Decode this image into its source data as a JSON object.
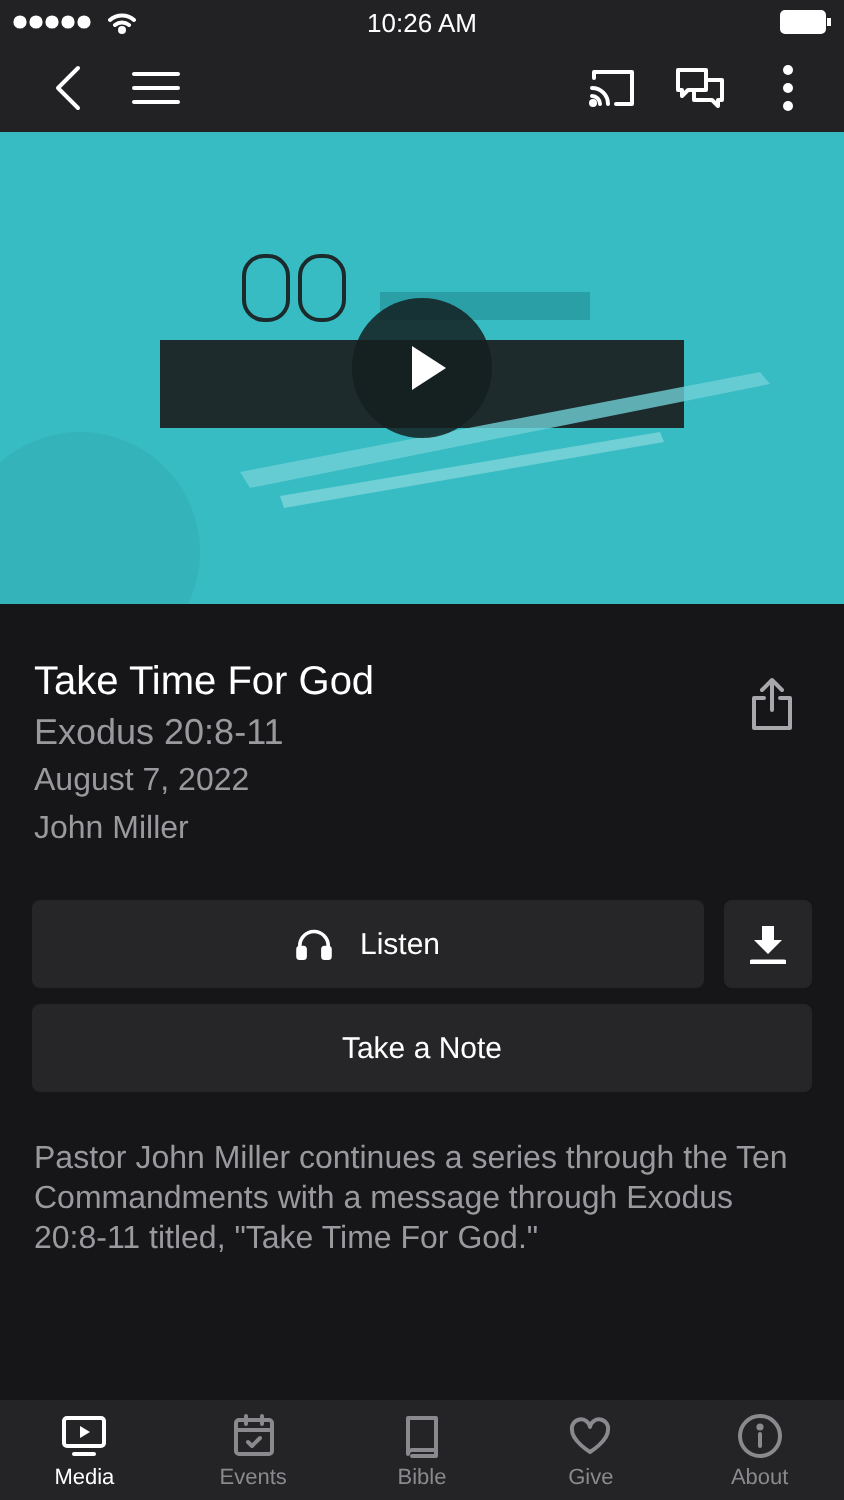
{
  "status_bar": {
    "time": "10:26 AM"
  },
  "sermon": {
    "title": "Take Time For God",
    "passage": "Exodus 20:8-11",
    "date": "August 7, 2022",
    "speaker": "John Miller"
  },
  "buttons": {
    "listen": "Listen",
    "note": "Take a Note"
  },
  "description": "Pastor John Miller continues a series through the Ten Commandments with a message through Exodus 20:8-11 titled, \"Take Time For God.\"",
  "tabs": [
    {
      "label": "Media",
      "selected": true
    },
    {
      "label": "Events",
      "selected": false
    },
    {
      "label": "Bible",
      "selected": false
    },
    {
      "label": "Give",
      "selected": false
    },
    {
      "label": "About",
      "selected": false
    }
  ]
}
